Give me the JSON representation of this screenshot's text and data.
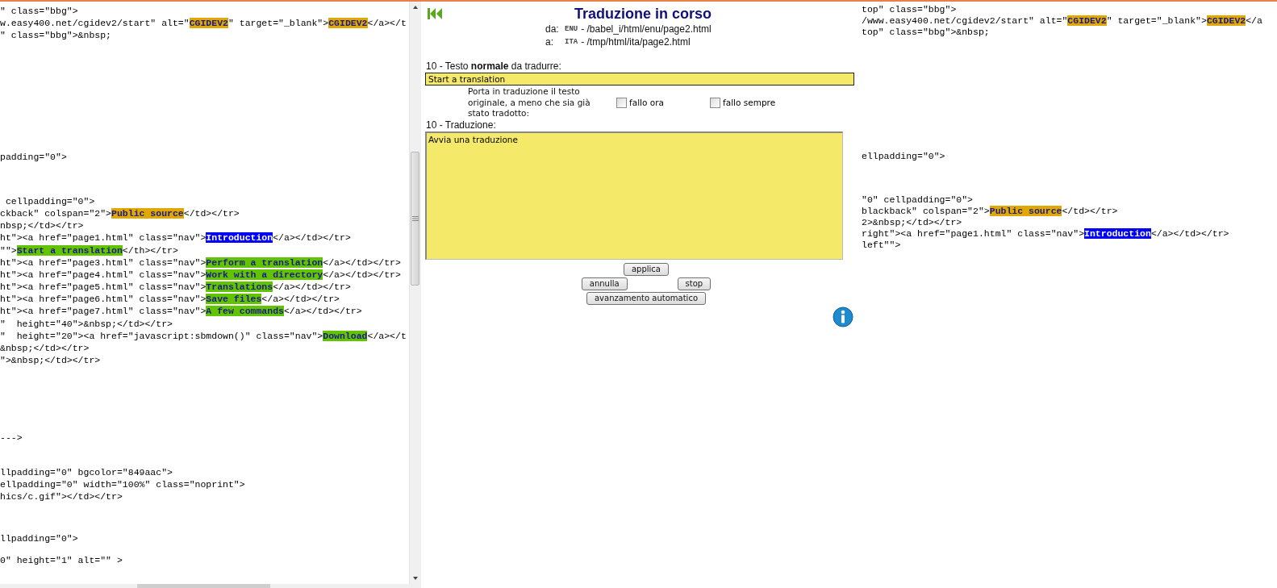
{
  "source_pane": {
    "blocks": [
      {
        "lines": [
          [
            {
              "text": "\" class=\"bbg\">",
              "kind": "plain"
            }
          ],
          [
            {
              "text": "w.easy400.net/cgidev2/start\" alt=\"",
              "kind": "plain"
            },
            {
              "text": "CGIDEV2",
              "kind": "tag"
            },
            {
              "text": "\" target=\"_blank\">",
              "kind": "plain"
            },
            {
              "text": "CGIDEV2",
              "kind": "tag"
            },
            {
              "text": "</a></t",
              "kind": "plain"
            }
          ],
          [
            {
              "text": "\" class=\"bbg\">&nbsp;",
              "kind": "plain"
            }
          ]
        ]
      },
      {
        "lines": [
          [
            {
              "text": "padding=\"0\">",
              "kind": "plain"
            }
          ]
        ]
      },
      {
        "lines": [
          [
            {
              "text": " cellpadding=\"0\">",
              "kind": "plain"
            }
          ],
          [
            {
              "text": "ckback\" colspan=\"2\">",
              "kind": "plain"
            },
            {
              "text": "Public source",
              "kind": "tag"
            },
            {
              "text": "</td></tr>",
              "kind": "plain"
            }
          ],
          [
            {
              "text": "nbsp;</td></tr>",
              "kind": "plain"
            }
          ],
          [
            {
              "text": "ht\"><a href=\"page1.html\" class=\"nav\">",
              "kind": "plain"
            },
            {
              "text": "Introduction",
              "kind": "current"
            },
            {
              "text": "</a></td></tr>",
              "kind": "plain"
            }
          ],
          [
            {
              "text": "\"\">",
              "kind": "plain"
            },
            {
              "text": "Start a translation",
              "kind": "done"
            },
            {
              "text": "</th></tr>",
              "kind": "plain"
            }
          ],
          [
            {
              "text": "ht\"><a href=\"page3.html\" class=\"nav\">",
              "kind": "plain"
            },
            {
              "text": "Perform a translation",
              "kind": "done"
            },
            {
              "text": "</a></td></tr>",
              "kind": "plain"
            }
          ],
          [
            {
              "text": "ht\"><a href=\"page4.html\" class=\"nav\">",
              "kind": "plain"
            },
            {
              "text": "Work with a directory",
              "kind": "done"
            },
            {
              "text": "</a></td></tr>",
              "kind": "plain"
            }
          ],
          [
            {
              "text": "ht\"><a href=\"page5.html\" class=\"nav\">",
              "kind": "plain"
            },
            {
              "text": "Translations",
              "kind": "done"
            },
            {
              "text": "</a></td></tr>",
              "kind": "plain"
            }
          ],
          [
            {
              "text": "ht\"><a href=\"page6.html\" class=\"nav\">",
              "kind": "plain"
            },
            {
              "text": "Save files",
              "kind": "done"
            },
            {
              "text": "</a></td></tr>",
              "kind": "plain"
            }
          ],
          [
            {
              "text": "ht\"><a href=\"page7.html\" class=\"nav\">",
              "kind": "plain"
            },
            {
              "text": "A few commands",
              "kind": "done"
            },
            {
              "text": "</a></td></tr>",
              "kind": "plain"
            }
          ],
          [
            {
              "text": "\"  height=\"40\">&nbsp;</td></tr>",
              "kind": "plain"
            }
          ],
          [
            {
              "text": "\"  height=\"20\"><a href=\"javascript:sbmdown()\" class=\"nav\">",
              "kind": "plain"
            },
            {
              "text": "Download",
              "kind": "done"
            },
            {
              "text": "</a></t",
              "kind": "plain"
            }
          ],
          [
            {
              "text": "&nbsp;</td></tr>",
              "kind": "plain"
            }
          ],
          [
            {
              "text": "\">&nbsp;</td></tr>",
              "kind": "plain"
            }
          ]
        ]
      },
      {
        "lines": [
          [
            {
              "text": "--->",
              "kind": "plain"
            }
          ]
        ]
      },
      {
        "lines": [
          [
            {
              "text": "llpadding=\"0\" bgcolor=\"849aac\">",
              "kind": "plain"
            }
          ],
          [
            {
              "text": "ellpadding=\"0\" width=\"100%\" class=\"noprint\">",
              "kind": "plain"
            }
          ],
          [
            {
              "text": "hics/c.gif\"></td></tr>",
              "kind": "plain"
            }
          ]
        ]
      },
      {
        "lines": [
          [
            {
              "text": "llpadding=\"0\">",
              "kind": "plain"
            }
          ]
        ]
      },
      {
        "lines": [
          [
            {
              "text": "0\" height=\"1\" alt=\"\" >",
              "kind": "plain"
            }
          ]
        ]
      }
    ]
  },
  "editor": {
    "title": "Traduzione in corso",
    "from": {
      "label": "da:",
      "lang": "ENU",
      "path": "- /babel_i/html/enu/page2.html"
    },
    "to": {
      "label": "a:",
      "lang": "ITA",
      "path": "- /tmp/html/ita/page2.html"
    },
    "source_label": "10 - Testo **normale** da tradurre:",
    "source_value": "Start a translation",
    "copy_note": "Porta in traduzione il testo originale, a meno che sia già stato tradotto:",
    "options": [
      {
        "label": "fallo ora",
        "checked": false
      },
      {
        "label": "fallo sempre",
        "checked": false
      }
    ],
    "translation_label": "10 - Traduzione:",
    "translation_value": "Avvia una traduzione",
    "button_rows": [
      [
        "applica"
      ],
      [
        "annulla",
        "stop"
      ],
      [
        "avanzamento automatico"
      ]
    ]
  },
  "target_pane": {
    "blocks": [
      {
        "lines": [
          [
            {
              "text": "top\" class=\"bbg\">",
              "kind": "plain"
            }
          ],
          [
            {
              "text": "/www.easy400.net/cgidev2/start\" alt=\"",
              "kind": "plain"
            },
            {
              "text": "CGIDEV2",
              "kind": "tag"
            },
            {
              "text": "\" target=\"_blank\">",
              "kind": "plain"
            },
            {
              "text": "CGIDEV2",
              "kind": "tag"
            },
            {
              "text": "</a",
              "kind": "plain"
            }
          ],
          [
            {
              "text": "top\" class=\"bbg\">&nbsp;",
              "kind": "plain"
            }
          ]
        ]
      },
      {
        "lines": [
          [
            {
              "text": "ellpadding=\"0\">",
              "kind": "plain"
            }
          ]
        ]
      },
      {
        "lines": [
          [
            {
              "text": "\"0\" cellpadding=\"0\">",
              "kind": "plain"
            }
          ],
          [
            {
              "text": "blackback\" colspan=\"2\">",
              "kind": "plain"
            },
            {
              "text": "Public source",
              "kind": "tag"
            },
            {
              "text": "</td></tr>",
              "kind": "plain"
            }
          ],
          [
            {
              "text": "2>&nbsp;</td></tr>",
              "kind": "plain"
            }
          ],
          [
            {
              "text": "right\"><a href=\"page1.html\" class=\"nav\">",
              "kind": "plain"
            },
            {
              "text": "Introduction",
              "kind": "current"
            },
            {
              "text": "</a></td></tr>",
              "kind": "plain"
            }
          ],
          [
            {
              "text": "left\"\">",
              "kind": "plain"
            }
          ]
        ]
      }
    ]
  }
}
